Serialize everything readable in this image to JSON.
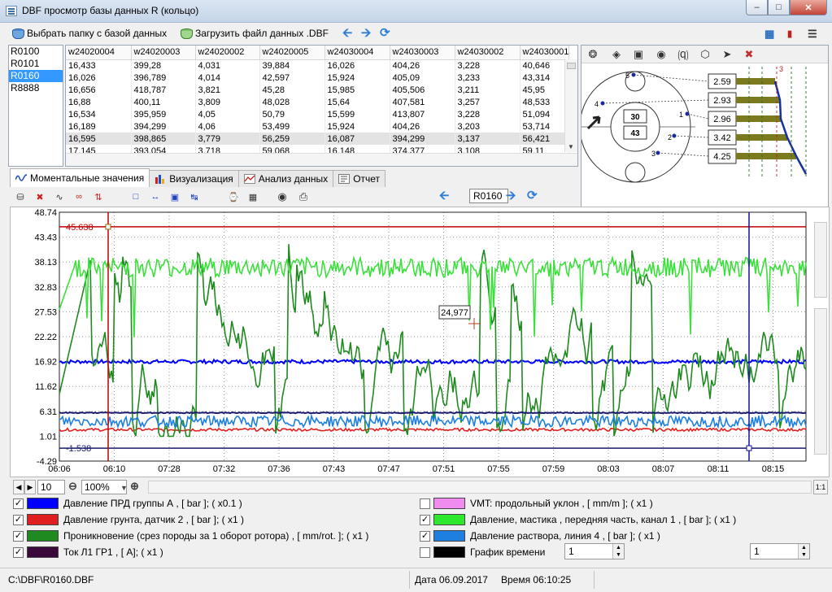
{
  "window": {
    "title": "DBF просмотр базы данных R (кольцо)",
    "buttons": [
      "minimize",
      "maximize",
      "close"
    ]
  },
  "toolbar": {
    "select_folder_label": "Выбрать папку с базой данных",
    "load_file_label": "Загрузить файл данных .DBF"
  },
  "series_list": {
    "items": [
      "R0100",
      "R0101",
      "R0160",
      "R8888"
    ],
    "selected": "R0160"
  },
  "table": {
    "columns": [
      "w24020004",
      "w24020003",
      "w24020002",
      "w24020005",
      "w24030004",
      "w24030003",
      "w24030002",
      "w24030001"
    ],
    "rows": [
      [
        "16,433",
        "399,28",
        "4,031",
        "39,884",
        "16,026",
        "404,26",
        "3,228",
        "40,646"
      ],
      [
        "16,026",
        "396,789",
        "4,014",
        "42,597",
        "15,924",
        "405,09",
        "3,233",
        "43,314"
      ],
      [
        "16,656",
        "418,787",
        "3,821",
        "45,28",
        "15,985",
        "405,506",
        "3,211",
        "45,95"
      ],
      [
        "16,88",
        "400,11",
        "3,809",
        "48,028",
        "15,64",
        "407,581",
        "3,257",
        "48,533"
      ],
      [
        "16,534",
        "395,959",
        "4,05",
        "50,79",
        "15,599",
        "413,807",
        "3,228",
        "51,094"
      ],
      [
        "16,189",
        "394,299",
        "4,06",
        "53,499",
        "15,924",
        "404,26",
        "3,203",
        "53,714"
      ],
      [
        "16,595",
        "398,865",
        "3,779",
        "56,259",
        "16,087",
        "394,299",
        "3,137",
        "56,421"
      ],
      [
        "17,145",
        "393,054",
        "3,718",
        "59,068",
        "16,148",
        "374,377",
        "3,108",
        "59,11"
      ]
    ],
    "highlighted_row": 6
  },
  "scheme": {
    "center_top": "30",
    "center_bottom": "43",
    "point_labels": [
      "1",
      "2",
      "3",
      "4",
      "5"
    ],
    "values": [
      "2.59",
      "2.93",
      "2.96",
      "3.42",
      "4.25"
    ],
    "corner_label": "3"
  },
  "tabs": [
    {
      "label": "Моментальные значения",
      "active": true
    },
    {
      "label": "Визуализация",
      "active": false
    },
    {
      "label": "Анализ данных",
      "active": false
    },
    {
      "label": "Отчет",
      "active": false
    }
  ],
  "chart_nav": {
    "current_file": "R0160"
  },
  "zoom": {
    "step": "10",
    "percent": "100%"
  },
  "chart_data": {
    "type": "line",
    "y_ticks": [
      "48.74",
      "43.43",
      "38.13",
      "32.83",
      "27.53",
      "22.22",
      "16.92",
      "11.62",
      "6.31",
      "1.01",
      "-4.29"
    ],
    "x_ticks": [
      "06:06",
      "06:10",
      "07:28",
      "07:32",
      "07:36",
      "07:43",
      "07:47",
      "07:51",
      "07:55",
      "07:59",
      "08:03",
      "08:07",
      "08:11",
      "08:15"
    ],
    "ylim": [
      -4.29,
      48.74
    ],
    "upper_limit": {
      "value": 45.638,
      "label": "45.638",
      "color": "#c00000"
    },
    "lower_limit": {
      "value": -1.538,
      "label": "-1.538",
      "color": "#1a1a6e"
    },
    "cursor_label": "24,977",
    "series": [
      {
        "name": "Давление ПРД группы А",
        "color": "#0000ff",
        "level": 16.9,
        "noise": 0.4
      },
      {
        "name": "Давление грунта, датчик 2",
        "color": "#e02020",
        "level": 2.4,
        "noise": 0.3
      },
      {
        "name": "Проникновение (срез породы за 1 оборот ротора)",
        "color": "#1f8a1f",
        "level": 18,
        "noise": 9
      },
      {
        "name": "Давление, мастика , передняя часть, канал 1",
        "color": "#3ddf3d",
        "level": 37,
        "noise": 3
      },
      {
        "name": "Давление раствора, линия 4",
        "color": "#1e7fe0",
        "level": 4.2,
        "noise": 1.2
      },
      {
        "name": "Ток Л1 ГР1",
        "color": "#1a1a6e",
        "level": 6.0,
        "noise": 0.1
      }
    ]
  },
  "legend": {
    "left": [
      {
        "label": "Давление ПРД группы А , [ bar ]; ( x0.1 )",
        "color": "#0000ff",
        "checked": true
      },
      {
        "label": "Давление грунта, датчик 2 , [ bar ]; ( x1 )",
        "color": "#e02020",
        "checked": true
      },
      {
        "label": "Проникновение (срез породы за 1 оборот ротора) , [ mm/rot. ]; ( x1 )",
        "color": "#1f8a1f",
        "checked": true
      },
      {
        "label": "Ток Л1 ГР1 , [ A]; ( x1 )",
        "color": "#3a0a3a",
        "checked": true
      }
    ],
    "right": [
      {
        "label": "VMT: продольный уклон , [ mm/m ]; ( x1 )",
        "color": "#f08cf0",
        "checked": false
      },
      {
        "label": "Давление, мастика , передняя часть, канал 1 , [ bar ]; ( x1 )",
        "color": "#2ee82e",
        "checked": true
      },
      {
        "label": "Давление раствора, линия 4 , [ bar ]; ( x1 )",
        "color": "#1e7fe0",
        "checked": true
      },
      {
        "label": "График времени",
        "color": "#000000",
        "checked": false
      }
    ],
    "spin_left": "1",
    "spin_right": "1"
  },
  "status": {
    "path": "C:\\DBF\\R0160.DBF",
    "date": "Дата 06.09.2017",
    "time": "Время 06:10:25"
  }
}
